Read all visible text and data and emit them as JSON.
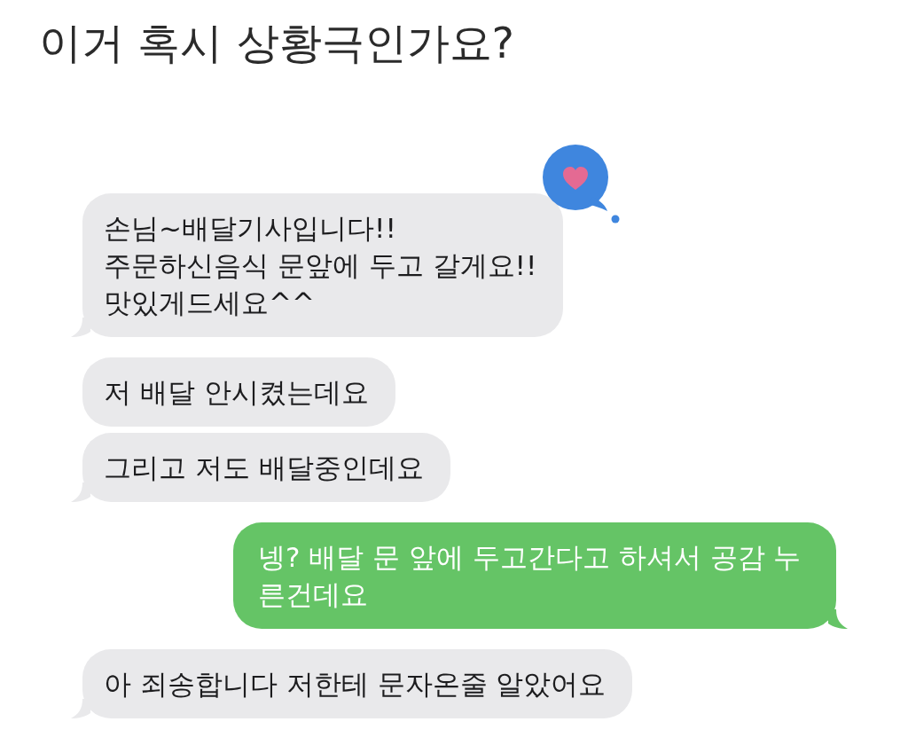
{
  "title": "이거 혹시 상황극인가요?",
  "messages": [
    {
      "kind": "received",
      "text": "손님~배달기사입니다!!\n주문하신음식 문앞에 두고 갈게요!!\n맛있게드세요^^",
      "tail": true,
      "reacted": true
    },
    {
      "kind": "received",
      "text": "저 배달 안시켰는데요",
      "tail": false,
      "reacted": false
    },
    {
      "kind": "received",
      "text": "그리고 저도 배달중인데요",
      "tail": true,
      "reacted": false
    },
    {
      "kind": "sent",
      "text": "넹? 배달 문 앞에 두고간다고 하셔서 공감 누른건데요",
      "tail": true,
      "reacted": false
    },
    {
      "kind": "received",
      "text": "아 죄송합니다 저한테 문자온줄 알았어요",
      "tail": true,
      "reacted": false
    }
  ]
}
